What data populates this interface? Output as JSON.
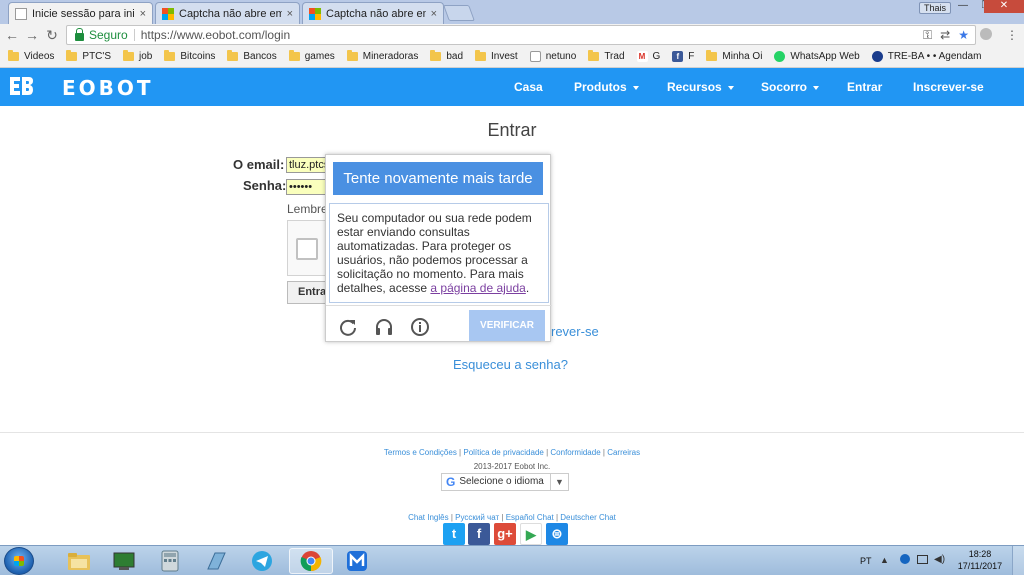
{
  "browser": {
    "tabs": [
      {
        "title": "Inicie sessão para iniciar",
        "close": "×"
      },
      {
        "title": "Captcha não abre em ne",
        "close": "×"
      },
      {
        "title": "Captcha não abre em ne",
        "close": "×"
      }
    ],
    "profile_name": "Thais",
    "window_controls": {
      "minimize": "—",
      "maximize": "❐",
      "close": "✕"
    },
    "nav": {
      "back": "←",
      "forward": "→",
      "reload": "↻"
    },
    "security_label": "Seguro",
    "url": "https://www.eobot.com/login",
    "bookmarks": [
      {
        "label": "Videos",
        "icon": "folder-icon"
      },
      {
        "label": "PTC'S",
        "icon": "folder-icon"
      },
      {
        "label": "job",
        "icon": "folder-icon"
      },
      {
        "label": "Bitcoins",
        "icon": "folder-icon"
      },
      {
        "label": "Bancos",
        "icon": "folder-icon"
      },
      {
        "label": "games",
        "icon": "folder-icon"
      },
      {
        "label": "Mineradoras",
        "icon": "folder-icon"
      },
      {
        "label": "bad",
        "icon": "folder-icon"
      },
      {
        "label": "Invest",
        "icon": "folder-icon"
      },
      {
        "label": "netuno",
        "icon": "page-icon"
      },
      {
        "label": "Trad",
        "icon": "folder-icon"
      },
      {
        "label": "G",
        "icon": "gmail-icon"
      },
      {
        "label": "F",
        "icon": "facebook-icon"
      },
      {
        "label": "Minha Oi",
        "icon": "folder-icon"
      },
      {
        "label": "WhatsApp Web",
        "icon": "whatsapp-icon"
      },
      {
        "label": "TRE-BA • • Agendam",
        "icon": "tre-icon"
      }
    ]
  },
  "site": {
    "brand": "EOBOT",
    "nav": [
      {
        "label": "Casa",
        "dropdown": false
      },
      {
        "label": "Produtos",
        "dropdown": true
      },
      {
        "label": "Recursos",
        "dropdown": true
      },
      {
        "label": "Socorro",
        "dropdown": true
      },
      {
        "label": "Entrar",
        "dropdown": false
      },
      {
        "label": "Inscrever-se",
        "dropdown": false
      }
    ],
    "accent": "#2196f3"
  },
  "login": {
    "title": "Entrar",
    "email_label": "O email:",
    "email_value": "tluz.ptcs",
    "password_label": "Senha:",
    "password_value": "••••••",
    "remember_label": "Lembre",
    "submit_label": "Entra",
    "signup_link": "rever-se",
    "forgot_link": "Esqueceu a senha?"
  },
  "captcha": {
    "header": "Tente novamente mais tarde",
    "message": "Seu computador ou sua rede podem estar enviando consultas automatizadas. Para proteger os usuários, não podemos processar a solicitação no momento. Para mais detalhes, acesse ",
    "help_link": "a página de ajuda",
    "message_end": ".",
    "verify_label": "VERIFICAR",
    "icons": [
      "reload-icon",
      "headphones-icon",
      "info-icon"
    ]
  },
  "footer": {
    "links": [
      "Termos e Condições",
      "Política de privacidade",
      "Conformidade",
      "Carreiras"
    ],
    "copyright": "2013-2017 Eobot Inc.",
    "language_select": "Selecione o idioma",
    "language_arrow": "▼",
    "chat_links": [
      "Chat Inglês",
      "Русский чат",
      "Español Chat",
      "Deutscher Chat"
    ],
    "social": [
      {
        "name": "twitter-icon",
        "color": "#1da1f2",
        "glyph": "t"
      },
      {
        "name": "facebook-icon",
        "color": "#3b5998",
        "glyph": "f"
      },
      {
        "name": "googleplus-icon",
        "color": "#dd4b39",
        "glyph": "g+"
      },
      {
        "name": "googleplay-icon",
        "color": "#ffffff",
        "glyph": "▶"
      },
      {
        "name": "app-icon",
        "color": "#1e88e5",
        "glyph": "⊜"
      }
    ]
  },
  "taskbar": {
    "apps": [
      "explorer-icon",
      "terminal-icon",
      "calculator-icon",
      "notepad-icon",
      "telegram-icon",
      "chrome-icon",
      "maxthon-icon"
    ],
    "active_app": "chrome-icon",
    "language": "PT",
    "time": "18:28",
    "date": "17/11/2017"
  }
}
